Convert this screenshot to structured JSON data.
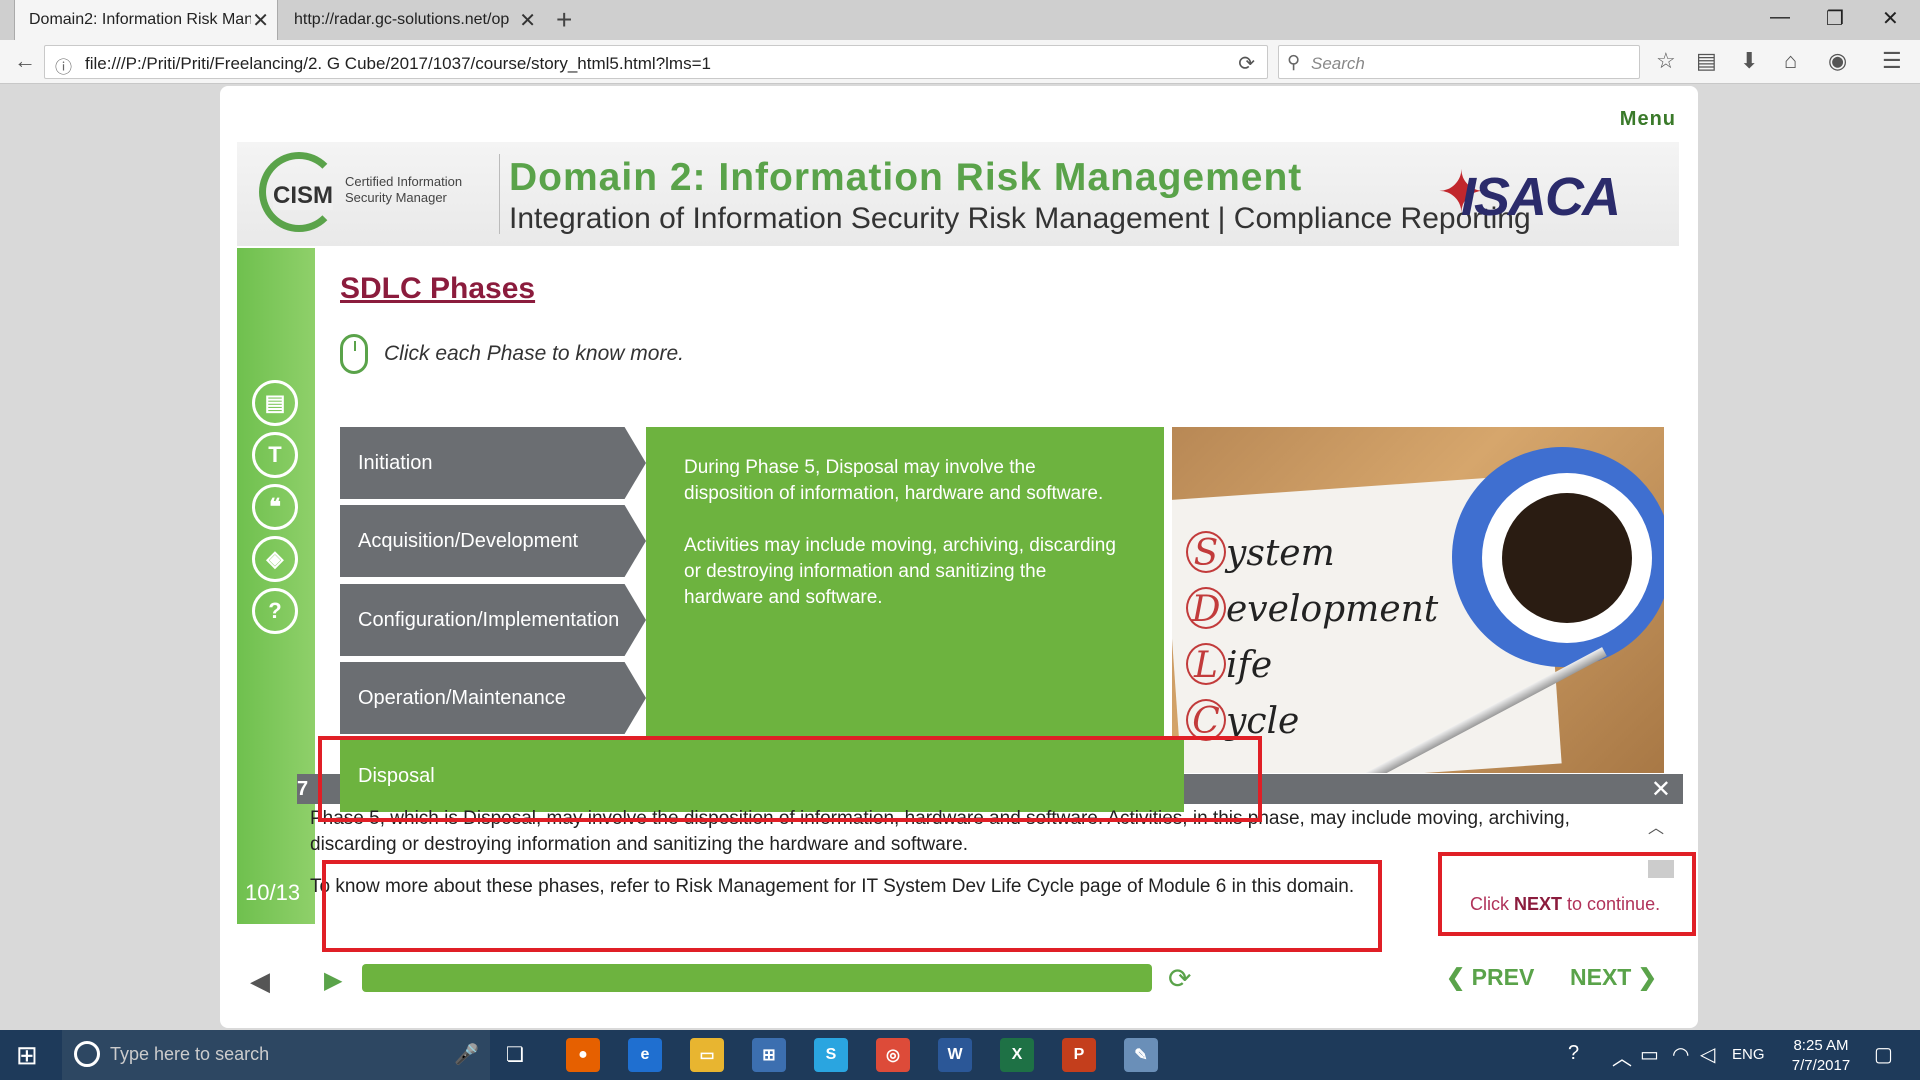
{
  "browser": {
    "tabs": [
      {
        "title": "Domain2: Information Risk Mana",
        "active": true
      },
      {
        "title": "http://radar.gc-solutions.net/op",
        "active": false
      }
    ],
    "url": "file:///P:/Priti/Priti/Freelancing/2. G Cube/2017/1037/course/story_html5.html?lms=1",
    "search_placeholder": "Search"
  },
  "course": {
    "menu_label": "Menu",
    "banner": {
      "cism_logo": "CISM",
      "cism_sub": "Certified Information Security Manager",
      "title": "Domain 2: Information Risk Management",
      "subtitle": "Integration of Information Security Risk Management | Compliance Reporting",
      "isaca_logo": "ISACA"
    },
    "page_number": "10/13",
    "heading": "SDLC Phases",
    "instruction": "Click each Phase to know more.",
    "phases": [
      {
        "label": "Initiation"
      },
      {
        "label": "Acquisition/Development"
      },
      {
        "label": "Configuration/Implementation"
      },
      {
        "label": "Operation/Maintenance"
      },
      {
        "label": "Disposal"
      }
    ],
    "description": {
      "p1": "During Phase 5, Disposal may involve the disposition of information, hardware and software.",
      "p2": "Activities may include moving, archiving, discarding or destroying information and sanitizing the hardware and software."
    },
    "photo_letters": [
      {
        "cap": "S",
        "rest": "ystem"
      },
      {
        "cap": "D",
        "rest": "evelopment"
      },
      {
        "cap": "L",
        "rest": "ife"
      },
      {
        "cap": "C",
        "rest": "ycle"
      }
    ],
    "transcript": {
      "marker": "7",
      "line1": "Phase 5, which is Disposal, may involve the disposition of information, hardware and software. Activities, in this phase, may include moving, archiving, discarding or destroying information and sanitizing the hardware and software.",
      "line2": "To know more about these phases, refer to Risk Management for IT System Dev Life Cycle page of Module 6 in this domain."
    },
    "click_next": {
      "pre": "Click ",
      "bold": "NEXT",
      "post": " to continue."
    },
    "nav": {
      "prev": "PREV",
      "next": "NEXT"
    },
    "colors": {
      "accent": "#6db33f",
      "heading": "#8b1c3d",
      "annotation": "#e01f26"
    }
  },
  "taskbar": {
    "search_placeholder": "Type here to search",
    "language": "ENG",
    "time": "8:25 AM",
    "date": "7/7/2017"
  }
}
